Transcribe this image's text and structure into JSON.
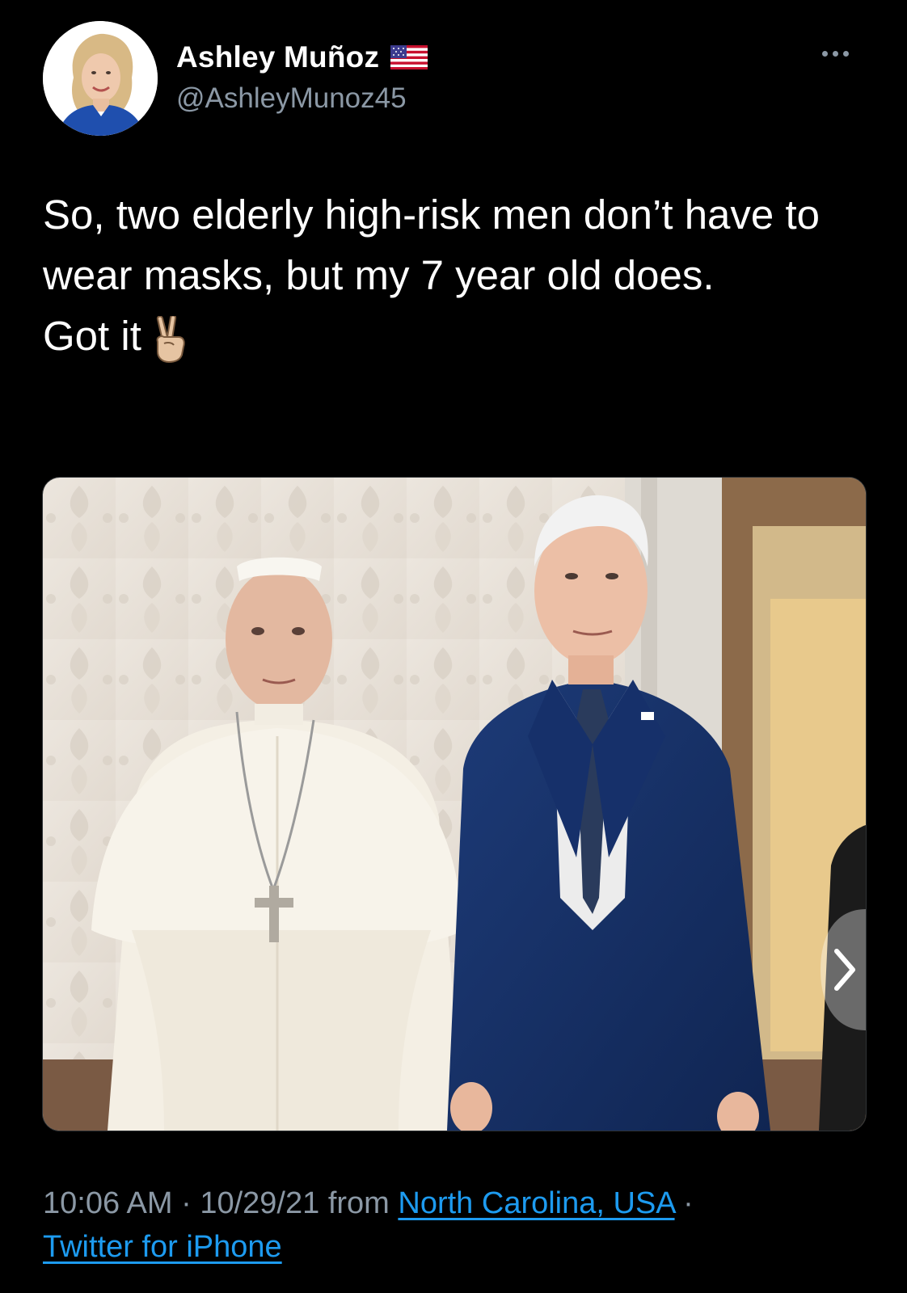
{
  "user": {
    "display_name": "Ashley Muñoz",
    "handle": "@AshleyMunoz45",
    "flag_icon": "us-flag-icon"
  },
  "tweet": {
    "lines": [
      "So, two elderly high-risk men don’t have to wear masks, but my 7 year old does.",
      "Got it"
    ],
    "emoji_icon": "victory-hand-icon"
  },
  "media": {
    "next_icon": "chevron-right-icon"
  },
  "meta": {
    "time": "10:06 AM",
    "separator": " · ",
    "date": "10/29/21",
    "from_label": " from ",
    "location": "North Carolina, USA",
    "separator2": " ·",
    "source": "Twitter for iPhone"
  },
  "colors": {
    "background": "#000000",
    "text": "#ffffff",
    "secondary": "#8b98a5",
    "link": "#1d9bf0"
  }
}
